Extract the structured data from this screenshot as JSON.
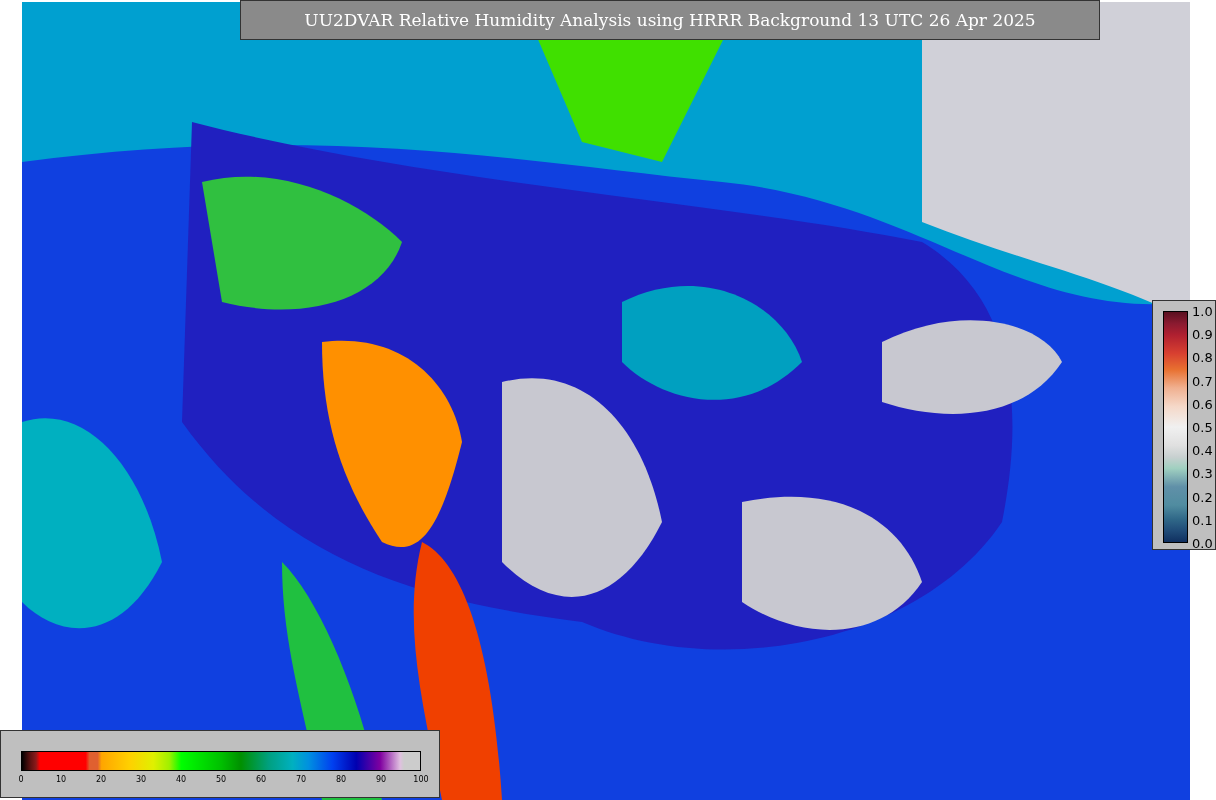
{
  "title": "UU2DVAR Relative Humidity Analysis using HRRR Background 13 UTC 26 Apr 2025",
  "humidity_colorbar": {
    "ticks": [
      "0",
      "10",
      "20",
      "30",
      "40",
      "50",
      "60",
      "70",
      "80",
      "90",
      "100"
    ]
  },
  "observation_colorbar": {
    "ticks": [
      "1.0",
      "0.9",
      "0.8",
      "0.7",
      "0.6",
      "0.5",
      "0.4",
      "0.3",
      "0.2",
      "0.1",
      "0.0"
    ]
  }
}
